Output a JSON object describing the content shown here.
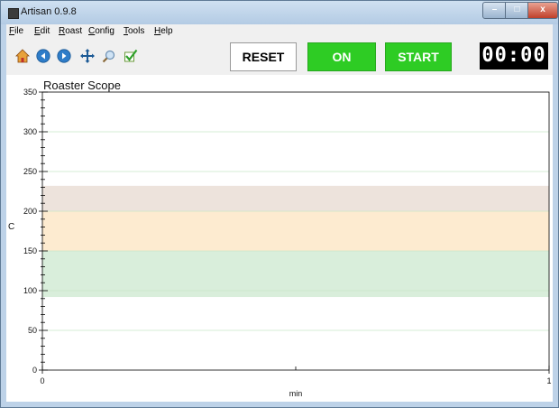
{
  "window": {
    "title": "Artisan 0.9.8"
  },
  "window_buttons": {
    "minimize": "–",
    "maximize": "□",
    "close": "x"
  },
  "menu": [
    "File",
    "Edit",
    "Roast",
    "Config",
    "Tools",
    "Help"
  ],
  "toolbar": {
    "icons": [
      "home-icon",
      "back-icon",
      "forward-icon",
      "pan-icon",
      "zoom-icon",
      "check-icon"
    ],
    "reset_label": "RESET",
    "on_label": "ON",
    "start_label": "START",
    "timer": "00:00"
  },
  "colors": {
    "on_green": "#2ecc24",
    "band_top": "#ede3dc",
    "band_mid": "#fdebd0",
    "band_low": "#d9eedb"
  },
  "chart_data": {
    "type": "line",
    "title": "Roaster Scope",
    "xlabel": "min",
    "ylabel": "C",
    "xlim": [
      0,
      1
    ],
    "ylim": [
      0,
      350
    ],
    "x_ticks": [
      "0",
      "1"
    ],
    "y_ticks": [
      "0",
      "50",
      "100",
      "150",
      "200",
      "250",
      "300",
      "350"
    ],
    "series": [],
    "bands": [
      {
        "from": 200,
        "to": 232,
        "color": "#ede3dc"
      },
      {
        "from": 150,
        "to": 200,
        "color": "#fdebd0"
      },
      {
        "from": 92,
        "to": 150,
        "color": "#d9eedb"
      }
    ],
    "grid": true
  }
}
